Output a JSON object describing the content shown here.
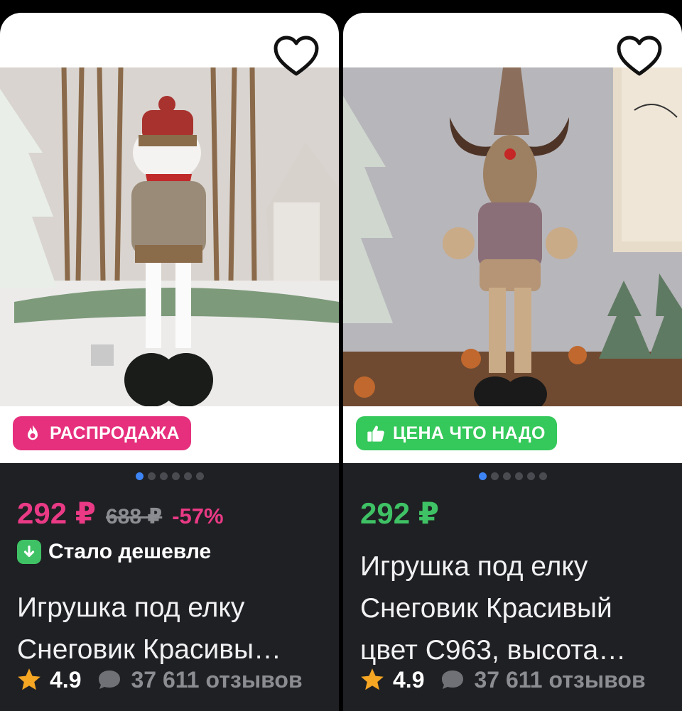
{
  "products": [
    {
      "badge": "РАСПРОДАЖА",
      "price": "292 ₽",
      "old_price": "688 ₽",
      "discount": "-57%",
      "cheaper_label": "Стало дешевле",
      "title_line1": "Игрушка под елку",
      "title_line2": "Снеговик Красивы…",
      "rating": "4.9",
      "reviews": "37 611 отзывов",
      "image_dots": 6,
      "active_dot": 0
    },
    {
      "badge": "ЦЕНА ЧТО НАДО",
      "price": "292 ₽",
      "title_line1": "Игрушка под елку",
      "title_line2": "Снеговик Красивый",
      "title_line3": "цвет C963, высота…",
      "rating": "4.9",
      "reviews": "37 611 отзывов",
      "image_dots": 6,
      "active_dot": 0
    }
  ],
  "colors": {
    "sale_badge": "#e6307d",
    "deal_badge": "#35c85b",
    "pink_price": "#ea3a86",
    "green_price": "#3fc265",
    "card_bg": "#1f2023",
    "active_dot": "#3d84f5"
  },
  "icons": {
    "favorite": "heart-outline-icon",
    "sale": "fire-icon",
    "deal": "thumbs-up-icon",
    "cheaper": "arrow-down-icon",
    "rating": "star-icon",
    "reviews": "chat-bubble-icon"
  }
}
